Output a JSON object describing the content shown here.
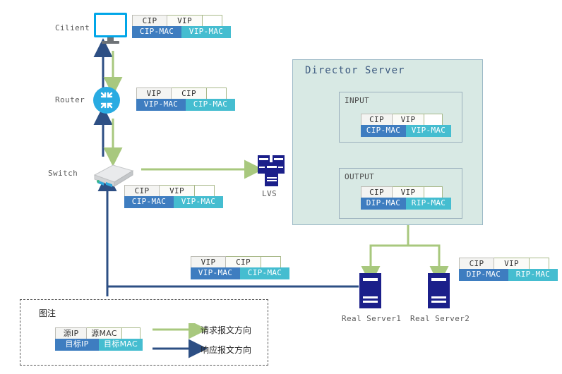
{
  "diagram": {
    "title_director": "Director Server",
    "nodes": {
      "client": "Cilient",
      "router": "Router",
      "switch": "Switch",
      "lvs": "LVS",
      "real_server1": "Real Server1",
      "real_server2": "Real Server2"
    },
    "sub_boxes": {
      "input": "INPUT",
      "output": "OUTPUT"
    },
    "flow_labels": {
      "vip": "VIP"
    },
    "packets": [
      {
        "id": "client-packet",
        "src_ip": "CIP",
        "dst_ip": "VIP",
        "src_mac": "CIP-MAC",
        "dst_mac": "VIP-MAC"
      },
      {
        "id": "router-packet",
        "src_ip": "VIP",
        "dst_ip": "CIP",
        "src_mac": "VIP-MAC",
        "dst_mac": "CIP-MAC"
      },
      {
        "id": "switch-packet",
        "src_ip": "CIP",
        "dst_ip": "VIP",
        "src_mac": "CIP-MAC",
        "dst_mac": "VIP-MAC"
      },
      {
        "id": "input-packet",
        "src_ip": "CIP",
        "dst_ip": "VIP",
        "src_mac": "CIP-MAC",
        "dst_mac": "VIP-MAC"
      },
      {
        "id": "output-packet",
        "src_ip": "CIP",
        "dst_ip": "VIP",
        "src_mac": "DIP-MAC",
        "dst_mac": "RIP-MAC"
      },
      {
        "id": "response-packet",
        "src_ip": "VIP",
        "dst_ip": "CIP",
        "src_mac": "VIP-MAC",
        "dst_mac": "CIP-MAC"
      },
      {
        "id": "realserver-packet",
        "src_ip": "CIP",
        "dst_ip": "VIP",
        "src_mac": "DIP-MAC",
        "dst_mac": "RIP-MAC"
      }
    ],
    "legend": {
      "title": "图注",
      "sample": {
        "src_ip": "源IP",
        "src_mac": "源MAC",
        "dst_ip": "目标IP",
        "dst_mac": "目标MAC"
      },
      "request_label": "请求报文方向",
      "response_label": "响应报文方向"
    },
    "colors": {
      "request_arrow": "#a8c87e",
      "response_arrow": "#2d4f84",
      "packet_ip_bg": "#f4f4f2",
      "packet_src_mac": "#3e7dc0",
      "packet_dst_mac": "#45bdd0",
      "director_bg": "#d8e9e4",
      "director_border": "#9bb8c6",
      "director_title": "#3d5a80",
      "server_navy": "#1b1f8a",
      "router_blue": "#29abe2",
      "monitor_blue": "#00a6e8"
    }
  }
}
